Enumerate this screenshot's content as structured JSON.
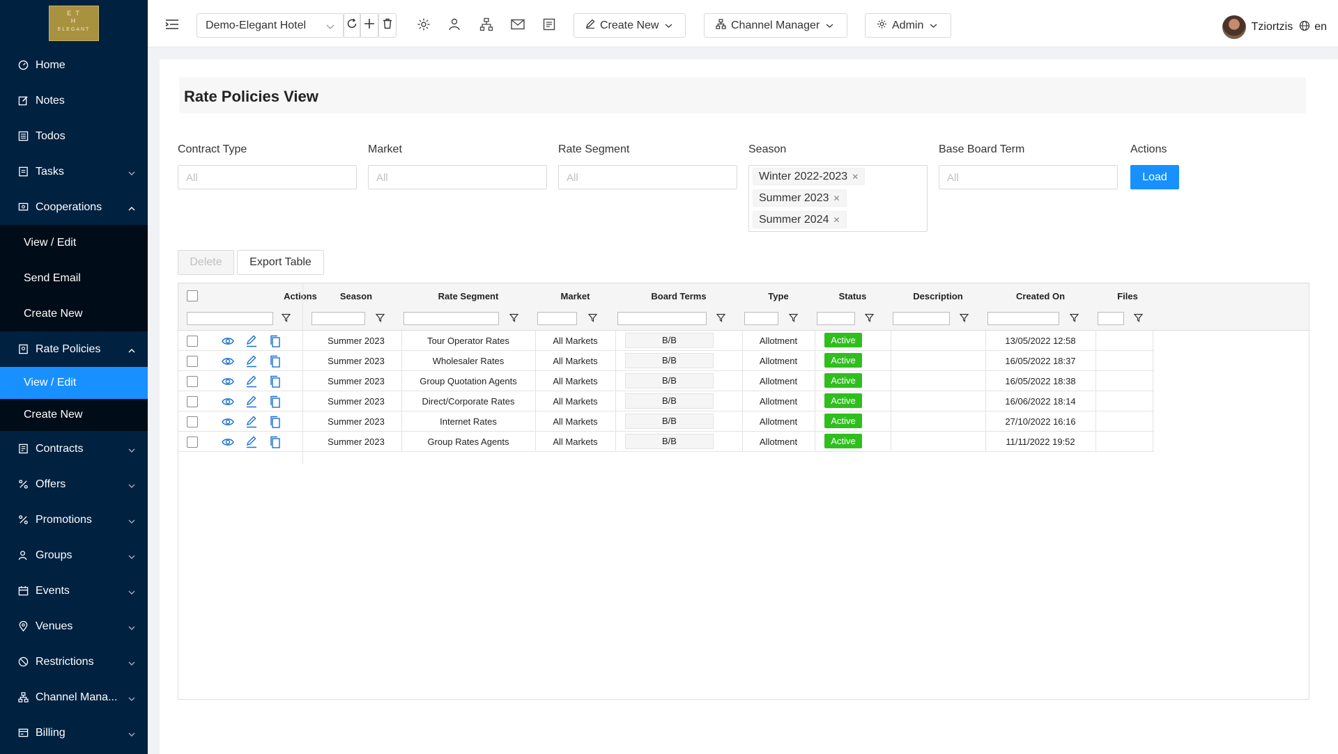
{
  "logo_text": "E T\nH\nELEGANT",
  "sidebar": {
    "items": [
      {
        "label": "Home",
        "icon": "dashboard-icon"
      },
      {
        "label": "Notes",
        "icon": "edit-icon"
      },
      {
        "label": "Todos",
        "icon": "list-icon"
      },
      {
        "label": "Tasks",
        "icon": "task-icon"
      },
      {
        "label": "Cooperations",
        "icon": "cooperation-icon"
      }
    ],
    "cooperations_sub": [
      "View / Edit",
      "Send Email",
      "Create New"
    ],
    "rate_policies": {
      "label": "Rate Policies",
      "icon": "policy-icon"
    },
    "rate_policies_sub": [
      "View / Edit",
      "Create New"
    ],
    "items2": [
      {
        "label": "Contracts",
        "icon": "contract-icon"
      },
      {
        "label": "Offers",
        "icon": "percent-icon"
      },
      {
        "label": "Promotions",
        "icon": "percent-icon"
      },
      {
        "label": "Groups",
        "icon": "group-icon"
      },
      {
        "label": "Events",
        "icon": "calendar-icon"
      },
      {
        "label": "Venues",
        "icon": "location-icon"
      },
      {
        "label": "Restrictions",
        "icon": "stop-icon"
      },
      {
        "label": "Channel Mana...",
        "icon": "channel-icon"
      },
      {
        "label": "Billing",
        "icon": "billing-icon"
      }
    ]
  },
  "topbar": {
    "hotel": "Demo-Elegant Hotel",
    "create_new": "Create New",
    "channel_manager": "Channel Manager",
    "admin": "Admin",
    "user_name": "Tziortzis",
    "language": "en"
  },
  "page": {
    "title": "Rate Policies View"
  },
  "filters": {
    "contract_type": {
      "label": "Contract Type",
      "placeholder": "All"
    },
    "market": {
      "label": "Market",
      "placeholder": "All"
    },
    "rate_segment": {
      "label": "Rate Segment",
      "placeholder": "All"
    },
    "season": {
      "label": "Season",
      "tags": [
        "Winter 2022-2023",
        "Summer 2023",
        "Summer 2024"
      ]
    },
    "base_board_term": {
      "label": "Base Board Term",
      "placeholder": "All"
    },
    "actions": {
      "label": "Actions",
      "load": "Load"
    }
  },
  "toolbar": {
    "delete": "Delete",
    "export": "Export Table"
  },
  "table": {
    "headers": [
      "Actions",
      "Season",
      "Rate Segment",
      "Market",
      "Board Terms",
      "Type",
      "Status",
      "Description",
      "Created On",
      "Files"
    ],
    "rows": [
      {
        "season": "Summer 2023",
        "segment": "Tour Operator Rates",
        "market": "All Markets",
        "board": "B/B",
        "type": "Allotment",
        "status": "Active",
        "description": "",
        "created": "13/05/2022 12:58",
        "files": ""
      },
      {
        "season": "Summer 2023",
        "segment": "Wholesaler Rates",
        "market": "All Markets",
        "board": "B/B",
        "type": "Allotment",
        "status": "Active",
        "description": "",
        "created": "16/05/2022 18:37",
        "files": ""
      },
      {
        "season": "Summer 2023",
        "segment": "Group Quotation Agents",
        "market": "All Markets",
        "board": "B/B",
        "type": "Allotment",
        "status": "Active",
        "description": "",
        "created": "16/05/2022 18:38",
        "files": ""
      },
      {
        "season": "Summer 2023",
        "segment": "Direct/Corporate Rates",
        "market": "All Markets",
        "board": "B/B",
        "type": "Allotment",
        "status": "Active",
        "description": "",
        "created": "16/06/2022 18:14",
        "files": ""
      },
      {
        "season": "Summer 2023",
        "segment": "Internet Rates",
        "market": "All Markets",
        "board": "B/B",
        "type": "Allotment",
        "status": "Active",
        "description": "",
        "created": "27/10/2022 16:16",
        "files": ""
      },
      {
        "season": "Summer 2023",
        "segment": "Group Rates Agents",
        "market": "All Markets",
        "board": "B/B",
        "type": "Allotment",
        "status": "Active",
        "description": "",
        "created": "11/11/2022 19:52",
        "files": ""
      }
    ]
  },
  "colors": {
    "sidebar": "#002140",
    "active": "#1890ff",
    "status_active": "#2fbe1e"
  }
}
